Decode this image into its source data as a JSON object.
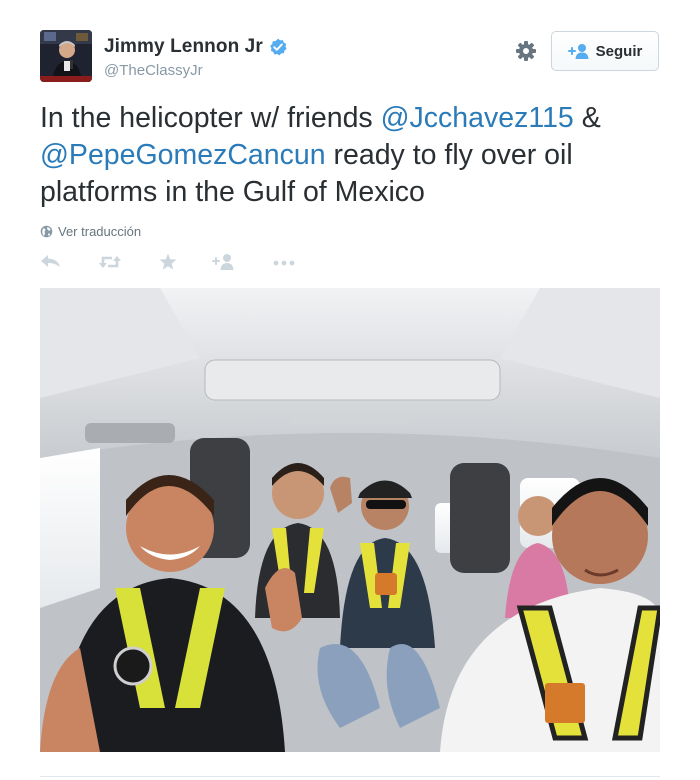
{
  "author": {
    "name": "Jimmy Lennon Jr",
    "handle": "@TheClassyJr",
    "verified": true
  },
  "follow_button": {
    "label": "Seguir"
  },
  "tweet": {
    "text_part1": "In the helicopter w/ friends ",
    "mention1": "@Jcchavez115",
    "text_part2": " & ",
    "mention2": "@PepeGomezCancun",
    "text_part3": " ready to fly over oil platforms in the Gulf of Mexico"
  },
  "translate_label": "Ver traducción",
  "actions": [
    "reply-icon",
    "retweet-icon",
    "favorite-icon",
    "follow-icon",
    "more-icon"
  ],
  "colors": {
    "link": "#2b7bb9",
    "verified": "#55acee",
    "text": "#292f33",
    "muted": "#8899a6",
    "action_icon": "#ccd6dd"
  }
}
